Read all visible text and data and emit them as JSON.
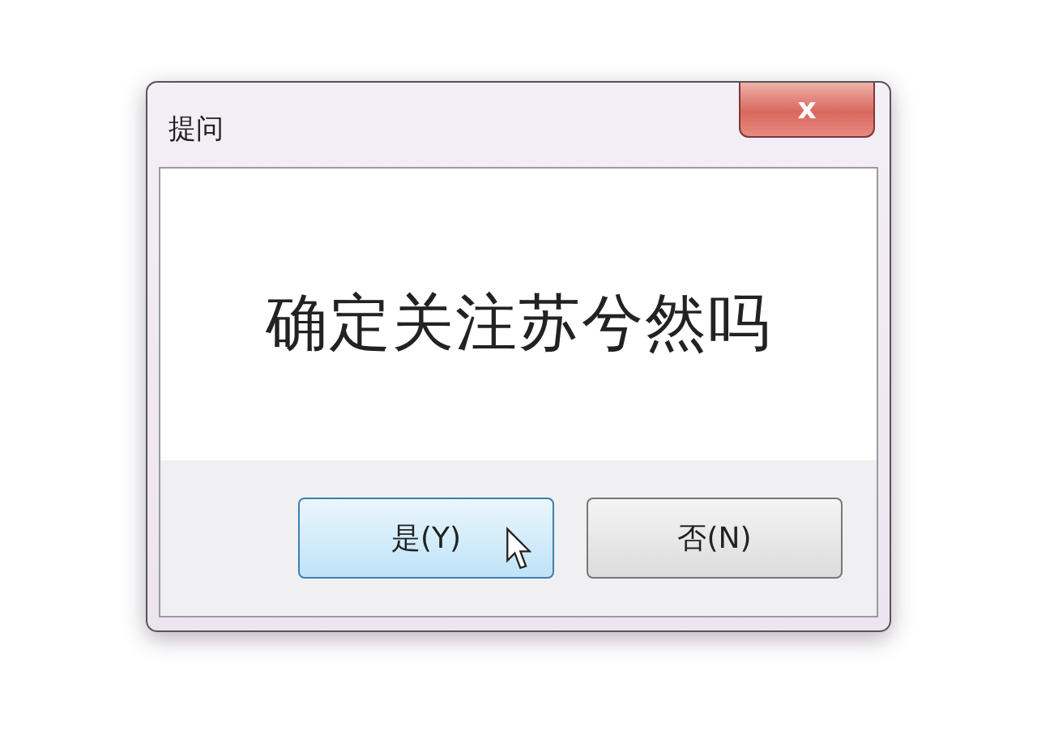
{
  "window": {
    "title": "提问",
    "close_label": "x"
  },
  "message": "确定关注苏兮然吗",
  "buttons": [
    {
      "label": "是(Y)",
      "hovered": true
    },
    {
      "label": "否(N)",
      "hovered": false
    }
  ]
}
